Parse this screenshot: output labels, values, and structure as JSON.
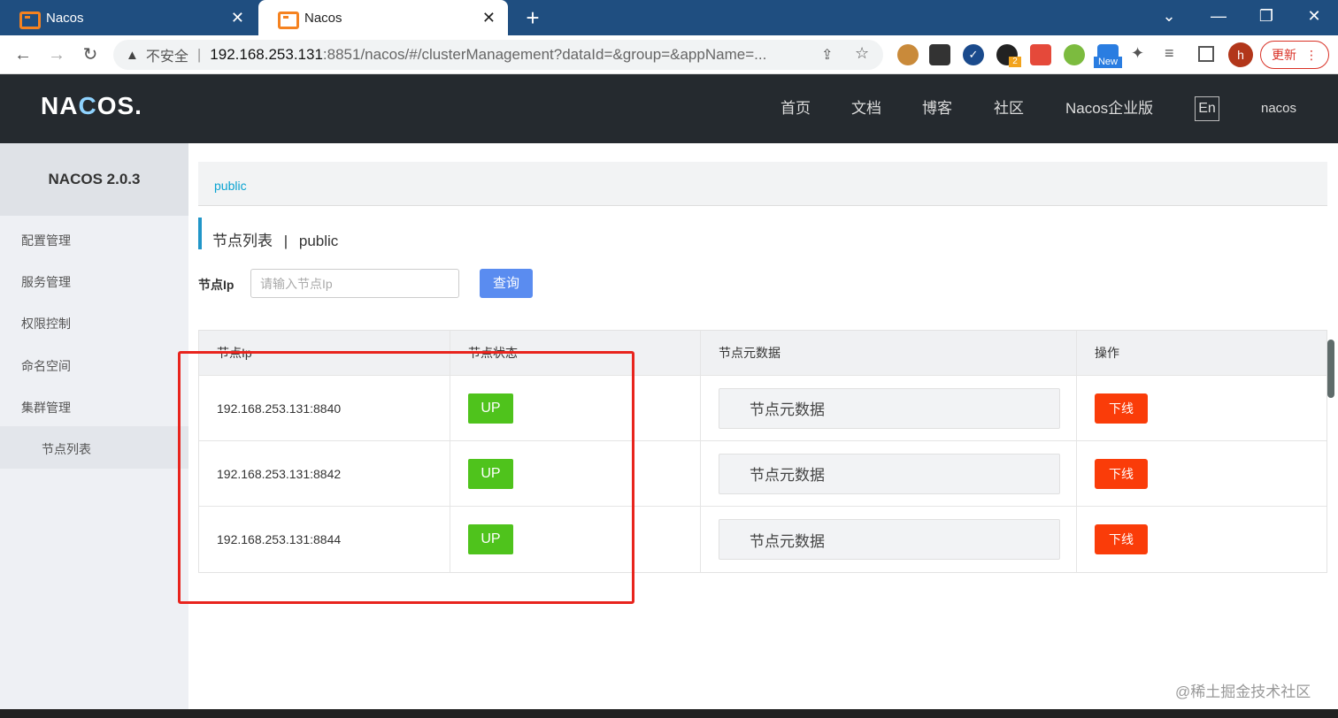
{
  "browser": {
    "tabs": [
      {
        "title": "Nacos",
        "close": "✕"
      },
      {
        "title": "Nacos",
        "close": "✕"
      }
    ],
    "new_tab": "+",
    "window_buttons": {
      "minimize": "—",
      "restore": "❐",
      "close": "✕",
      "dropdown": "⌄"
    },
    "nav": {
      "back": "←",
      "forward": "→",
      "reload": "↻"
    },
    "address": {
      "warning_icon": "▲",
      "insecure_label": "不安全",
      "separator": "|",
      "host": "192.168.253.131",
      "rest": ":8851/nacos/#/clusterManagement?dataId=&group=&appName=..."
    },
    "extensions_badge_new": "New",
    "extensions_badge_count": "2",
    "avatar_letter": "h",
    "update_label": "更新",
    "menu_icon": "⋮"
  },
  "header": {
    "logo": {
      "part1": "NA",
      "part2": "C",
      "part3": "OS."
    },
    "nav": [
      "首页",
      "文档",
      "博客",
      "社区",
      "Nacos企业版"
    ],
    "lang": "En",
    "user": "nacos"
  },
  "sidebar": {
    "title": "NACOS 2.0.3",
    "items": [
      "配置管理",
      "服务管理",
      "权限控制",
      "命名空间",
      "集群管理"
    ],
    "sub_items": [
      "节点列表"
    ]
  },
  "main": {
    "breadcrumb": "public",
    "page_title": "节点列表",
    "title_sep": "|",
    "namespace": "public",
    "filter": {
      "label": "节点Ip",
      "placeholder": "请输入节点Ip",
      "query_label": "查询"
    },
    "table": {
      "headers": [
        "节点Ip",
        "节点状态",
        "节点元数据",
        "操作"
      ],
      "rows": [
        {
          "ip": "192.168.253.131:8840",
          "state": "UP",
          "meta": "节点元数据",
          "action": "下线"
        },
        {
          "ip": "192.168.253.131:8842",
          "state": "UP",
          "meta": "节点元数据",
          "action": "下线"
        },
        {
          "ip": "192.168.253.131:8844",
          "state": "UP",
          "meta": "节点元数据",
          "action": "下线"
        }
      ]
    }
  },
  "watermark": "@稀土掘金技术社区",
  "colors": {
    "header_bg": "#252a2f",
    "status_up": "#4fc31c",
    "offline": "#fa3c09",
    "query": "#5a8cf0",
    "annotation": "#e8241d"
  }
}
